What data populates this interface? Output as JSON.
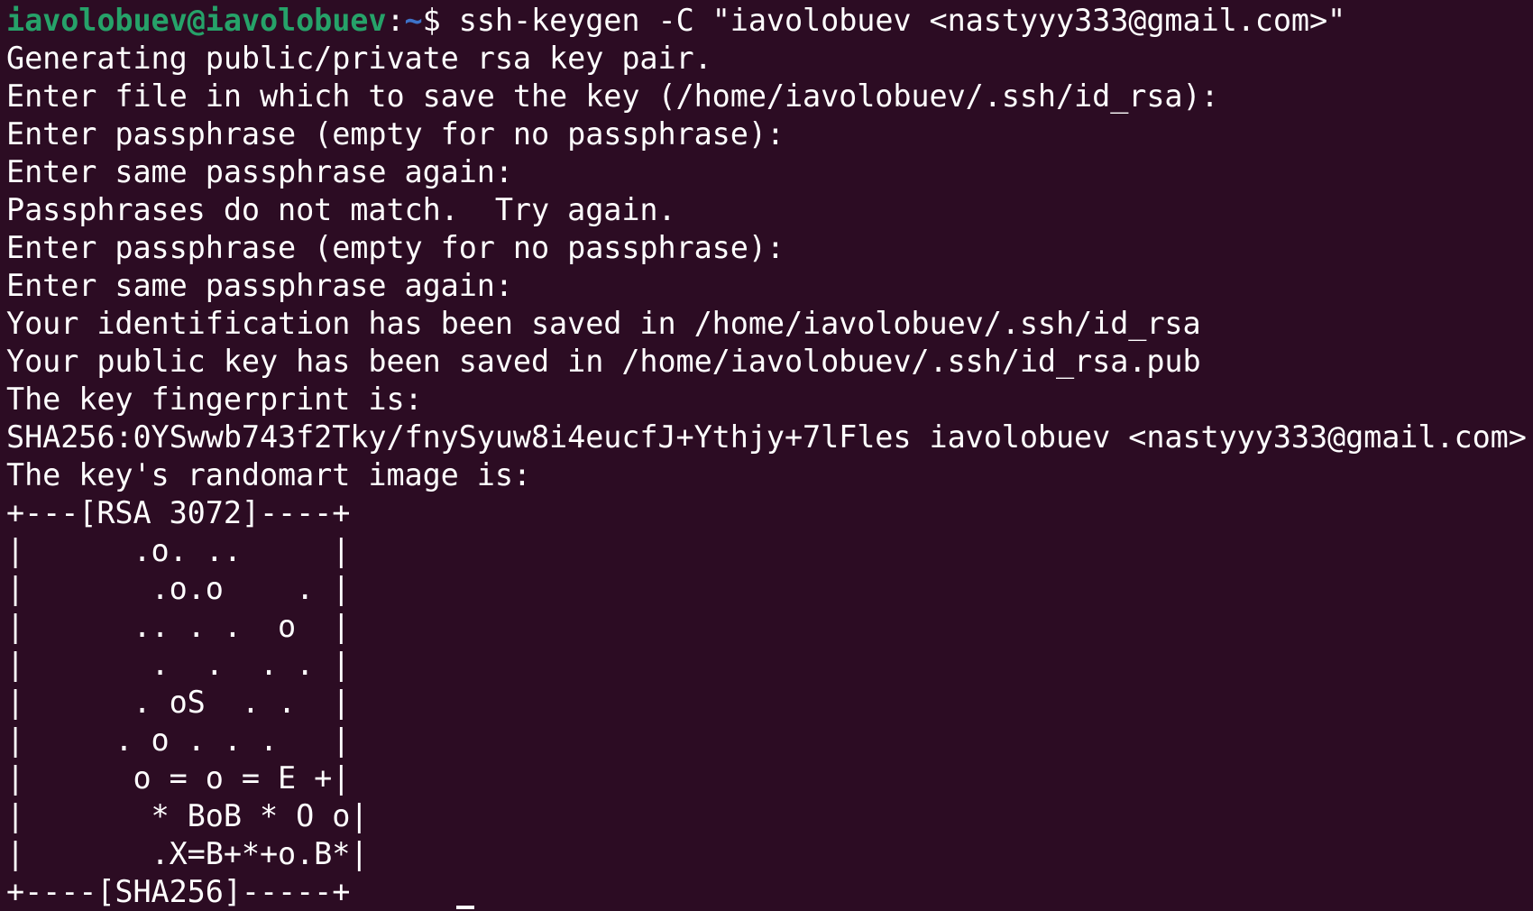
{
  "prompt": {
    "user_host": "iavolobuev@iavolobuev",
    "colon": ":",
    "path": "~",
    "symbol": "$ ",
    "command": "ssh-keygen -C \"iavolobuev <nastyyy333@gmail.com>\""
  },
  "output": [
    "Generating public/private rsa key pair.",
    "Enter file in which to save the key (/home/iavolobuev/.ssh/id_rsa):",
    "Enter passphrase (empty for no passphrase):",
    "Enter same passphrase again:",
    "Passphrases do not match.  Try again.",
    "Enter passphrase (empty for no passphrase):",
    "Enter same passphrase again:",
    "Your identification has been saved in /home/iavolobuev/.ssh/id_rsa",
    "Your public key has been saved in /home/iavolobuev/.ssh/id_rsa.pub",
    "The key fingerprint is:",
    "SHA256:0YSwwb743f2Tky/fnySyuw8i4eucfJ+Ythjy+7lFles iavolobuev <nastyyy333@gmail.com>",
    "The key's randomart image is:",
    "+---[RSA 3072]----+",
    "|      .o. ..     |",
    "|       .o.o    . |",
    "|      .. . .  o  |",
    "|       .  .  . . |",
    "|      . oS  . .  |",
    "|     . o . . .   |",
    "|      o = o = E +|",
    "|       * BoB * O o|",
    "|       .X=B+*+o.B*|",
    "+----[SHA256]-----+"
  ],
  "colors": {
    "background": "#2c0c23",
    "text": "#ffffff",
    "prompt_user": "#26a269",
    "prompt_path": "#3d73c9"
  }
}
